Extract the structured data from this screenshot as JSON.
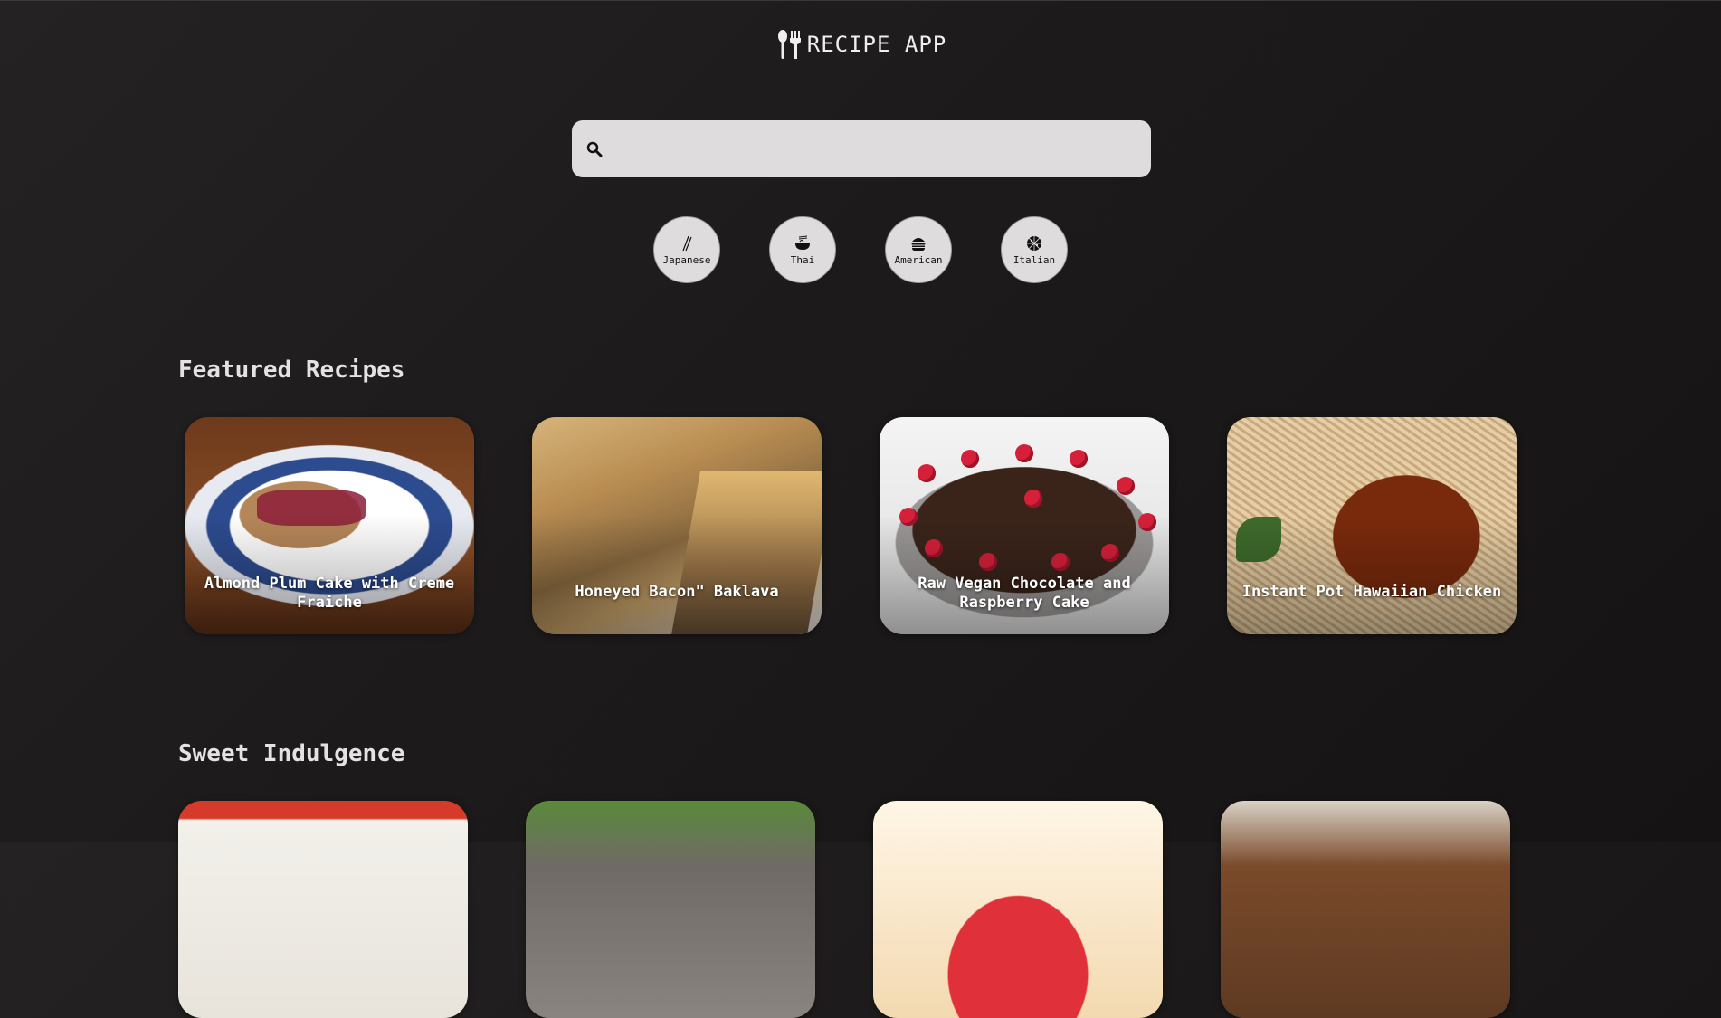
{
  "app": {
    "title": "RECIPE APP"
  },
  "search": {
    "value": "",
    "placeholder": ""
  },
  "cuisines": [
    {
      "label": "Japanese",
      "icon": "chopsticks-icon"
    },
    {
      "label": "Thai",
      "icon": "noodle-bowl-icon"
    },
    {
      "label": "American",
      "icon": "burger-icon"
    },
    {
      "label": "Italian",
      "icon": "pizza-icon"
    }
  ],
  "sections": [
    {
      "title": "Featured Recipes",
      "cards": [
        {
          "title": "Almond Plum Cake with Creme Fraiche"
        },
        {
          "title": "Honeyed Bacon\" Baklava"
        },
        {
          "title": "Raw Vegan Chocolate and Raspberry Cake"
        },
        {
          "title": "Instant Pot Hawaiian Chicken"
        }
      ]
    },
    {
      "title": "Sweet Indulgence",
      "cards": [
        {
          "title": ""
        },
        {
          "title": ""
        },
        {
          "title": ""
        },
        {
          "title": ""
        }
      ]
    }
  ]
}
